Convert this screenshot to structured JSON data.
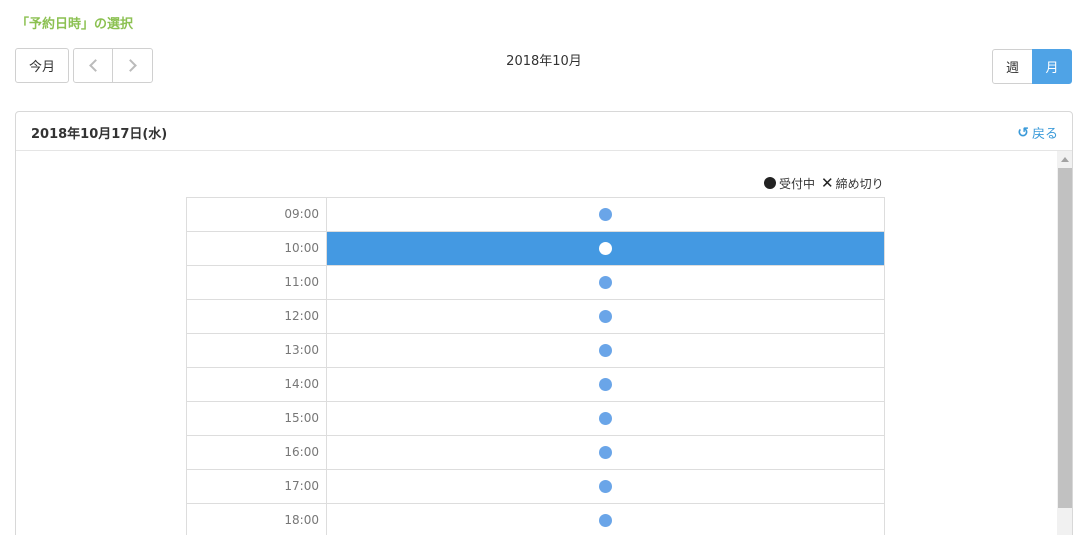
{
  "section_title": "「予約日時」の選択",
  "toolbar": {
    "today_label": "今月",
    "month_label": "2018年10月",
    "week_label": "週",
    "month_view_label": "月"
  },
  "panel": {
    "date_label": "2018年10月17日(水)",
    "back_label": "戻る"
  },
  "legend": {
    "available_label": "受付中",
    "closed_label": "締め切り"
  },
  "slots": [
    {
      "time": "09:00",
      "status": "available",
      "selected": false
    },
    {
      "time": "10:00",
      "status": "available",
      "selected": true
    },
    {
      "time": "11:00",
      "status": "available",
      "selected": false
    },
    {
      "time": "12:00",
      "status": "available",
      "selected": false
    },
    {
      "time": "13:00",
      "status": "available",
      "selected": false
    },
    {
      "time": "14:00",
      "status": "available",
      "selected": false
    },
    {
      "time": "15:00",
      "status": "available",
      "selected": false
    },
    {
      "time": "16:00",
      "status": "available",
      "selected": false
    },
    {
      "time": "17:00",
      "status": "available",
      "selected": false
    },
    {
      "time": "18:00",
      "status": "available",
      "selected": false
    }
  ],
  "colors": {
    "title_green": "#8cc152",
    "accent_blue": "#4fa3e6",
    "selected_row": "#4499e2",
    "dot_blue": "#6aa5e8"
  }
}
